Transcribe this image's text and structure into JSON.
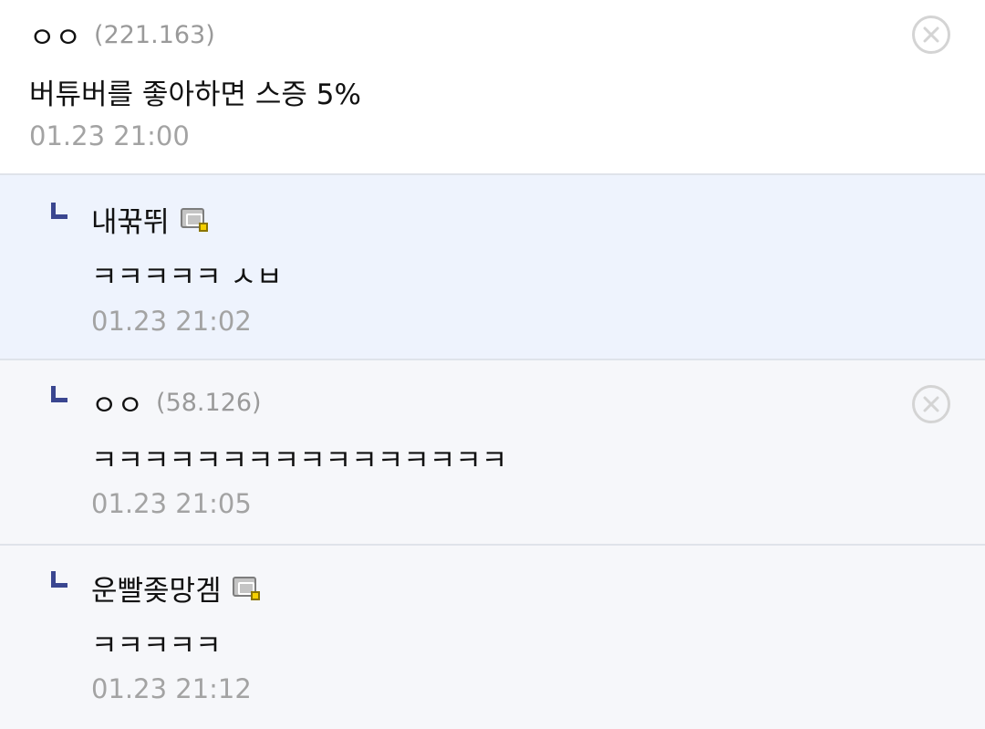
{
  "comments": [
    {
      "nick": "ㅇㅇ",
      "ip": "(221.163)",
      "text": "버튜버를 좋아하면 스증 5%",
      "date": "01.23 21:00",
      "delete_icon": "circle-x-icon"
    },
    {
      "nick": "내꾺뛰",
      "badge_icon": "fixed-nick-icon",
      "text": "ㅋㅋㅋㅋㅋ ㅅㅂ",
      "date": "01.23 21:02"
    },
    {
      "nick": "ㅇㅇ",
      "ip": "(58.126)",
      "text": "ㅋㅋㅋㅋㅋㅋㅋㅋㅋㅋㅋㅋㅋㅋㅋㅋ",
      "date": "01.23 21:05",
      "delete_icon": "circle-x-icon"
    },
    {
      "nick": "운빨좆망겜",
      "badge_icon": "fixed-nick-icon",
      "text": "ㅋㅋㅋㅋㅋ",
      "date": "01.23 21:12"
    }
  ],
  "colors": {
    "reply_highlight_bg": "#eef3fd",
    "reply_bg": "#f6f7fa",
    "reply_mark": "#3a4690",
    "meta_gray": "#a3a3a3"
  }
}
